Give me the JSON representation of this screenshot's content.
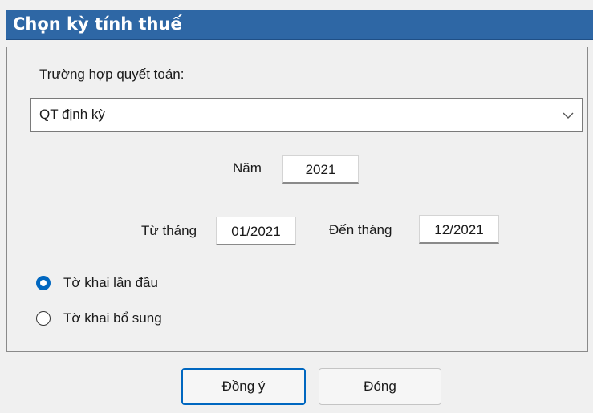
{
  "window": {
    "title": "Chọn kỳ tính thuế"
  },
  "settlement": {
    "label": "Trường hợp quyết toán:",
    "selected": "QT định kỳ"
  },
  "year": {
    "label": "Năm",
    "value": "2021"
  },
  "period": {
    "from_label": "Từ tháng",
    "from_value": "01/2021",
    "to_label": "Đến tháng",
    "to_value": "12/2021"
  },
  "declaration_type": {
    "options": [
      {
        "label": "Tờ khai lần đầu",
        "checked": true
      },
      {
        "label": "Tờ khai bổ sung",
        "checked": false
      }
    ]
  },
  "buttons": {
    "ok": "Đồng ý",
    "close": "Đóng"
  },
  "colors": {
    "titlebar": "#2e67a5",
    "accent": "#0067c0"
  }
}
